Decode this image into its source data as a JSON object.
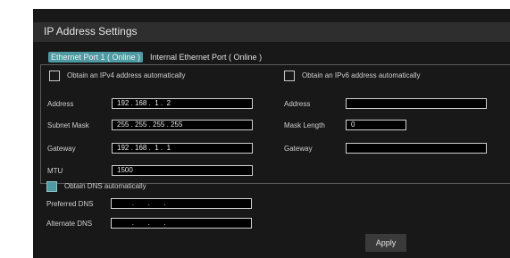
{
  "window": {
    "title": "IP Address Settings"
  },
  "tabs": [
    {
      "label": "Ethernet Port 1 ( Online )",
      "active": true
    },
    {
      "label": "Internal Ethernet Port ( Online )",
      "active": false
    }
  ],
  "ipv4": {
    "auto_label": "Obtain an IPv4 address automatically",
    "auto_checked": false,
    "address_label": "Address",
    "address_value": "192 . 168 .  1 .  2",
    "subnet_label": "Subnet Mask",
    "subnet_value": "255 . 255 . 255 . 255",
    "gateway_label": "Gateway",
    "gateway_value": "192 . 168 .  1 .  1",
    "mtu_label": "MTU",
    "mtu_value": "1500"
  },
  "ipv6": {
    "auto_label": "Obtain an IPv6 address automatically",
    "auto_checked": false,
    "address_label": "Address",
    "address_value": "",
    "mask_label": "Mask Length",
    "mask_value": "0",
    "gateway_label": "Gateway",
    "gateway_value": ""
  },
  "dns": {
    "auto_label": "Obtain DNS automatically",
    "auto_checked": true,
    "preferred_label": "Preferred DNS",
    "preferred_value": "        .       .       .",
    "alternate_label": "Alternate DNS",
    "alternate_value": "        .       .       ."
  },
  "apply_label": "Apply"
}
